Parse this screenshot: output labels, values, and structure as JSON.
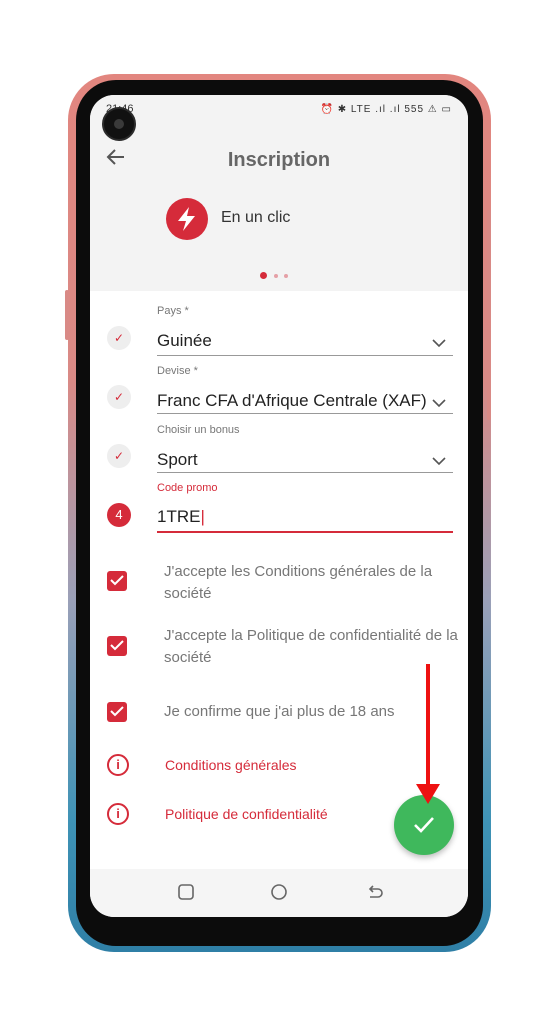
{
  "status": {
    "time": "21:46",
    "icons": "⏰ ✱ LTE .ıl .ıl 555 ⚠ ▭"
  },
  "header": {
    "title": "Inscription",
    "one_click": "En un clic",
    "dots": 3
  },
  "form": {
    "country": {
      "label": "Pays *",
      "value": "Guinée"
    },
    "currency": {
      "label": "Devise *",
      "value": "Franc CFA d'Afrique Centrale (XAF)"
    },
    "bonus": {
      "label": "Choisir un bonus",
      "value": "Sport"
    },
    "promo": {
      "label": "Code promo",
      "value": "1TRE",
      "step": "4"
    },
    "checks": [
      {
        "text": "J'accepte les Conditions générales de la société"
      },
      {
        "text": "J'accepte la Politique de confidentialité de la société"
      },
      {
        "text": "Je confirme que j'ai plus de 18 ans"
      }
    ],
    "links": [
      {
        "text": "Conditions générales"
      },
      {
        "text": "Politique de confidentialité"
      }
    ]
  },
  "colors": {
    "accent": "#d52b3a",
    "confirm": "#3fb85c",
    "annotation": "#ee1111"
  },
  "icons": {
    "back": "arrow-left-icon",
    "one_click": "lightning-bolt-icon",
    "check": "check-icon",
    "info": "info-icon",
    "chevron": "chevron-down-icon"
  }
}
